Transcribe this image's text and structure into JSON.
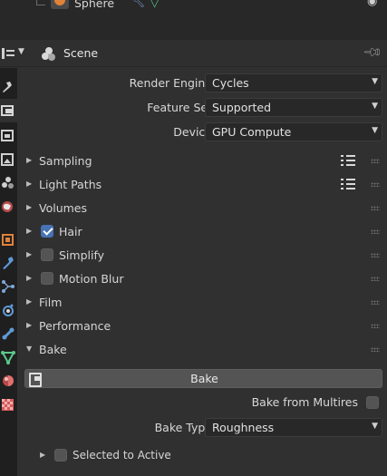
{
  "outliner": {
    "object_name": "Sphere",
    "icons": [
      "object-icon",
      "modifier-icon",
      "mesh-data-icon",
      "eye-icon"
    ]
  },
  "header": {
    "title": "Scene",
    "editor_icon": "properties-editor-icon",
    "context_icon": "scene-icon",
    "pin_icon": "pin-icon"
  },
  "tabs": [
    {
      "name": "tool",
      "icon": "tool-icon",
      "color": "#d0d0d0"
    },
    {
      "name": "render",
      "icon": "render-icon",
      "color": "#d0d0d0",
      "active": true
    },
    {
      "name": "output",
      "icon": "output-icon",
      "color": "#d0d0d0"
    },
    {
      "name": "view-layer",
      "icon": "view-layer-icon",
      "color": "#d0d0d0"
    },
    {
      "name": "scene",
      "icon": "scene-icon",
      "color": "#d0d0d0"
    },
    {
      "name": "world",
      "icon": "world-icon",
      "color": "#d85a5a"
    },
    {
      "name": "object",
      "icon": "object-icon",
      "color": "#e0823a"
    },
    {
      "name": "modifiers",
      "icon": "wrench-icon",
      "color": "#5e9ad6"
    },
    {
      "name": "particles",
      "icon": "particles-icon",
      "color": "#7fa8d8"
    },
    {
      "name": "physics",
      "icon": "physics-icon",
      "color": "#5e9ad6"
    },
    {
      "name": "constraints",
      "icon": "constraints-icon",
      "color": "#5e9ad6"
    },
    {
      "name": "data",
      "icon": "mesh-data-icon",
      "color": "#5cc88c"
    },
    {
      "name": "material",
      "icon": "material-icon",
      "color": "#d85a5a"
    },
    {
      "name": "texture",
      "icon": "texture-icon",
      "color": "#d85a5a"
    }
  ],
  "render": {
    "engine_label": "Render Engine",
    "engine_value": "Cycles",
    "feature_label": "Feature Set",
    "feature_value": "Supported",
    "device_label": "Device",
    "device_value": "GPU Compute"
  },
  "panels": {
    "sampling": "Sampling",
    "light_paths": "Light Paths",
    "volumes": "Volumes",
    "hair": "Hair",
    "simplify": "Simplify",
    "motion_blur": "Motion Blur",
    "film": "Film",
    "performance": "Performance",
    "bake": "Bake"
  },
  "checkboxes": {
    "hair": true,
    "simplify": false,
    "motion_blur": false,
    "bake_from_multires": false,
    "selected_to_active": false
  },
  "bake": {
    "button_label": "Bake",
    "multires_label": "Bake from Multires",
    "type_label": "Bake Type",
    "type_value": "Roughness",
    "selected_to_active_label": "Selected to Active"
  },
  "colors": {
    "accent": "#4772b3",
    "background": "#303030",
    "tab_bar": "#1f1f1f"
  }
}
